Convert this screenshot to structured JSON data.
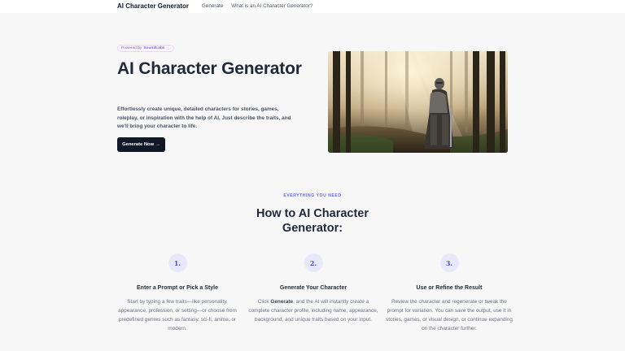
{
  "header": {
    "brand": "AI Character Generator",
    "nav": [
      "Generate",
      "What is an AI Character Generator?"
    ]
  },
  "hero": {
    "badge_prefix": "Powered by",
    "badge_brand": "SoundLabs",
    "badge_chevron": "→",
    "title": "AI Character Generator",
    "description": "Effortlessly create unique, detailed characters for stories, games, roleplay, or inspiration with the help of AI. Just describe the traits, and we'll bring your character to life.",
    "cta_label": "Generate Now",
    "cta_arrow": "→",
    "image_icon": "armored-knight-in-forest-image"
  },
  "how": {
    "eyebrow": "EVERYTHING YOU NEED",
    "title": "How to AI Character Generator:",
    "steps": [
      {
        "num": "1.",
        "title": "Enter a Prompt or Pick a Style",
        "desc_before": "Start by typing a few traits—like personality, appearance, profession, or setting—or choose from predefined genres such as fantasy, sci-fi, anime, or modern.",
        "desc_bold": "",
        "desc_after": ""
      },
      {
        "num": "2.",
        "title": "Generate Your Character",
        "desc_before": "Click ",
        "desc_bold": "Generate",
        "desc_after": ", and the AI will instantly create a complete character profile, including name, appearance, background, and unique traits based on your input."
      },
      {
        "num": "3.",
        "title": "Use or Refine the Result",
        "desc_before": "Review the character and regenerate or tweak the prompt for variation. You can save the output, use it in stories, games, or visual design, or continue expanding on the character further.",
        "desc_bold": "",
        "desc_after": ""
      }
    ]
  },
  "colors": {
    "accent": "#6366f1",
    "cta_bg": "#111827",
    "badge_text": "#8b5cf6",
    "page_bg": "#f7f7f8"
  }
}
